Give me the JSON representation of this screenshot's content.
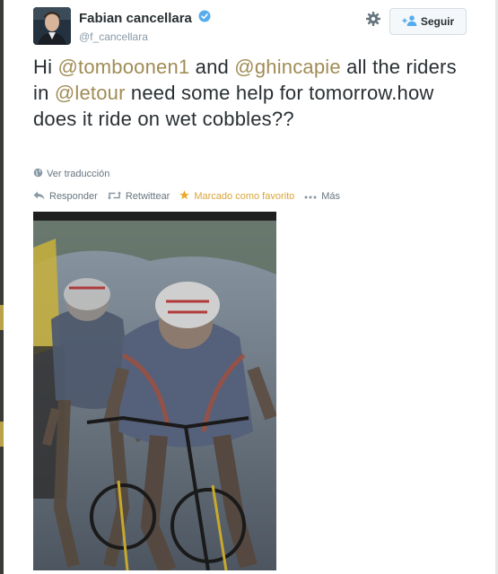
{
  "user": {
    "display_name": "Fabian cancellara",
    "handle": "@f_cancellara",
    "verified": true
  },
  "follow_button": {
    "label": "Seguir"
  },
  "tweet": {
    "segments": [
      {
        "text": "Hi ",
        "type": "text"
      },
      {
        "text": "@tomboonen1",
        "type": "mention"
      },
      {
        "text": " and ",
        "type": "text"
      },
      {
        "text": "@ghincapie",
        "type": "mention"
      },
      {
        "text": " all the riders in ",
        "type": "text"
      },
      {
        "text": "@letour",
        "type": "mention"
      },
      {
        "text": " need some help for tomorrow.how does it ride on wet cobbles??",
        "type": "text"
      }
    ]
  },
  "translate": {
    "label": "Ver traducción"
  },
  "actions": {
    "reply": "Responder",
    "retweet": "Retwittear",
    "favorite": "Marcado como favorito",
    "more": "Más"
  },
  "colors": {
    "mention": "#a08c55",
    "favorite": "#d9a53a",
    "verified": "#55acee"
  },
  "icons": {
    "settings": "gear-icon",
    "follow": "add-user-icon",
    "translate": "globe-icon",
    "reply": "reply-icon",
    "retweet": "retweet-icon",
    "favorite": "star-icon",
    "more": "more-dots-icon"
  }
}
